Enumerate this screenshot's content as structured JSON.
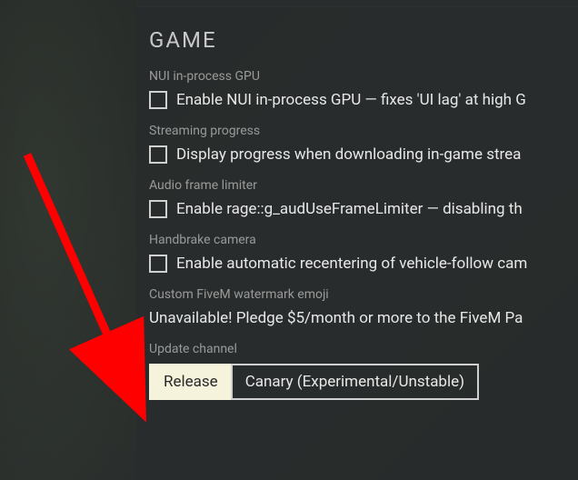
{
  "section": {
    "title": "GAME"
  },
  "settings": {
    "nui_gpu": {
      "label": "NUI in-process GPU",
      "checkbox_text": "Enable NUI in-process GPU — fixes 'UI lag' at high G"
    },
    "streaming": {
      "label": "Streaming progress",
      "checkbox_text": "Display progress when downloading in-game strea"
    },
    "audio_limiter": {
      "label": "Audio frame limiter",
      "checkbox_text": "Enable rage::g_audUseFrameLimiter — disabling th"
    },
    "handbrake": {
      "label": "Handbrake camera",
      "checkbox_text": "Enable automatic recentering of vehicle-follow cam"
    },
    "watermark": {
      "label": "Custom FiveM watermark emoji",
      "text": "Unavailable! Pledge $5/month or more to the FiveM Pa"
    },
    "update_channel": {
      "label": "Update channel",
      "options": {
        "release": "Release",
        "canary": "Canary (Experimental/Unstable)"
      }
    }
  }
}
